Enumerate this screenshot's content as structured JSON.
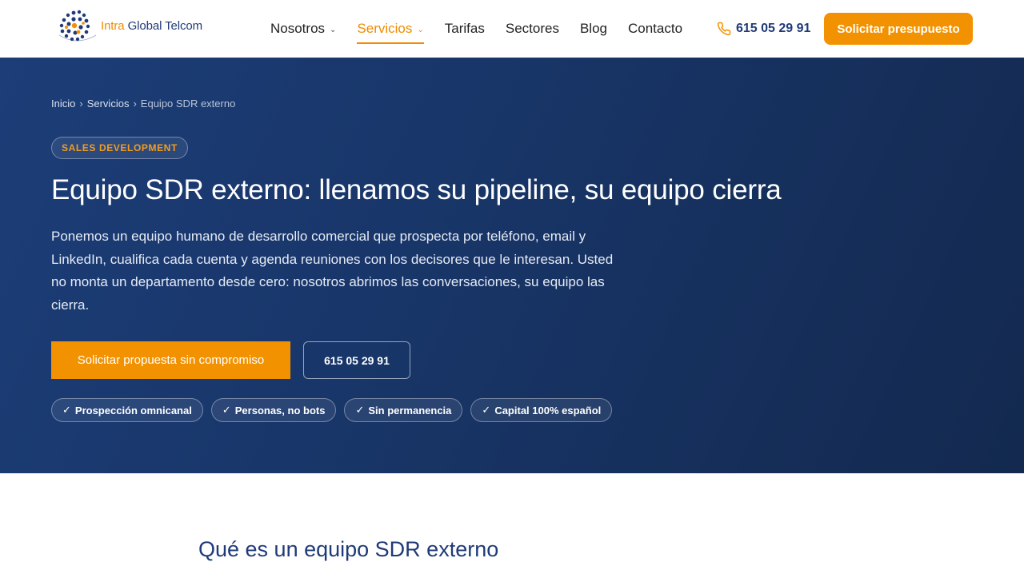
{
  "header": {
    "logo": {
      "part1": "Intra",
      "part2": " Global Telcom"
    },
    "nav": [
      {
        "label": "Nosotros",
        "has_dropdown": true,
        "active": false
      },
      {
        "label": "Servicios",
        "has_dropdown": true,
        "active": true
      },
      {
        "label": "Tarifas",
        "has_dropdown": false,
        "active": false
      },
      {
        "label": "Sectores",
        "has_dropdown": false,
        "active": false
      },
      {
        "label": "Blog",
        "has_dropdown": false,
        "active": false
      },
      {
        "label": "Contacto",
        "has_dropdown": false,
        "active": false
      }
    ],
    "phone": "615 05 29 91",
    "cta": "Solicitar presupuesto"
  },
  "hero": {
    "breadcrumb": [
      "Inicio",
      "Servicios",
      "Equipo SDR externo"
    ],
    "breadcrumb_separator": "›",
    "badge": "SALES DEVELOPMENT",
    "title": "Equipo SDR externo: llenamos su pipeline, su equipo cierra",
    "description": "Ponemos un equipo humano de desarrollo comercial que prospecta por teléfono, email y LinkedIn, cualifica cada cuenta y agenda reuniones con los decisores que le interesan. Usted no monta un departamento desde cero: nosotros abrimos las conversaciones, su equipo las cierra.",
    "primary_button": "Solicitar propuesta sin compromiso",
    "secondary_button": "615 05 29 91",
    "features": [
      "Prospección omnicanal",
      "Personas, no bots",
      "Sin permanencia",
      "Capital 100% español"
    ]
  },
  "section": {
    "title": "Qué es un equipo SDR externo"
  },
  "colors": {
    "accent": "#f39200",
    "brand_navy": "#1f3a78",
    "hero_bg_start": "#1c3d78",
    "hero_bg_end": "#13294f"
  },
  "icons": {
    "check": "✓",
    "chevron": "⌄",
    "phone": "phone-icon"
  }
}
